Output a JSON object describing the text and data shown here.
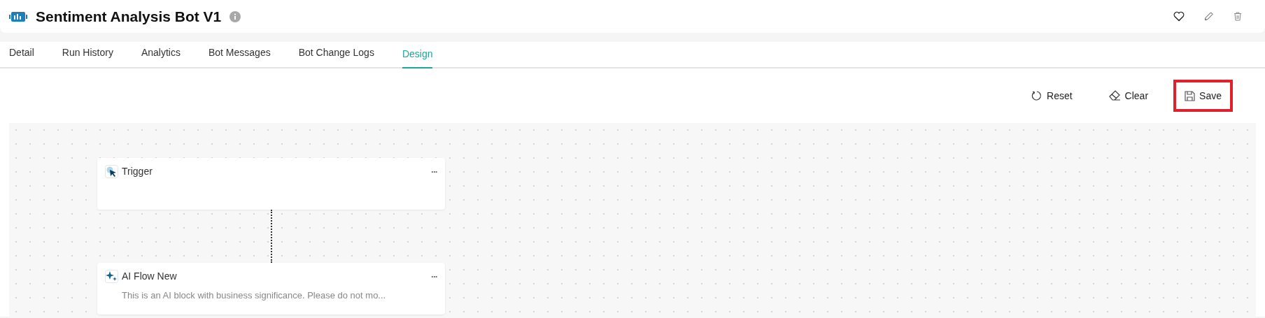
{
  "header": {
    "title": "Sentiment Analysis Bot V1"
  },
  "tabs": [
    {
      "label": "Detail",
      "selected": false
    },
    {
      "label": "Run History",
      "selected": false
    },
    {
      "label": "Analytics",
      "selected": false
    },
    {
      "label": "Bot Messages",
      "selected": false
    },
    {
      "label": "Bot Change Logs",
      "selected": false
    },
    {
      "label": "Design",
      "selected": true
    }
  ],
  "toolbar": [
    {
      "kind": "reset",
      "label": "Reset",
      "highlighted": false
    },
    {
      "kind": "clear",
      "label": "Clear",
      "highlighted": false
    },
    {
      "kind": "save",
      "label": "Save",
      "highlighted": true
    }
  ],
  "nodes": [
    {
      "kind": "trigger",
      "title": "Trigger",
      "more": "•••"
    },
    {
      "kind": "ai",
      "title": "AI Flow New",
      "description": "This is an AI block with business significance. Please do not mo...",
      "more": "•••"
    }
  ]
}
